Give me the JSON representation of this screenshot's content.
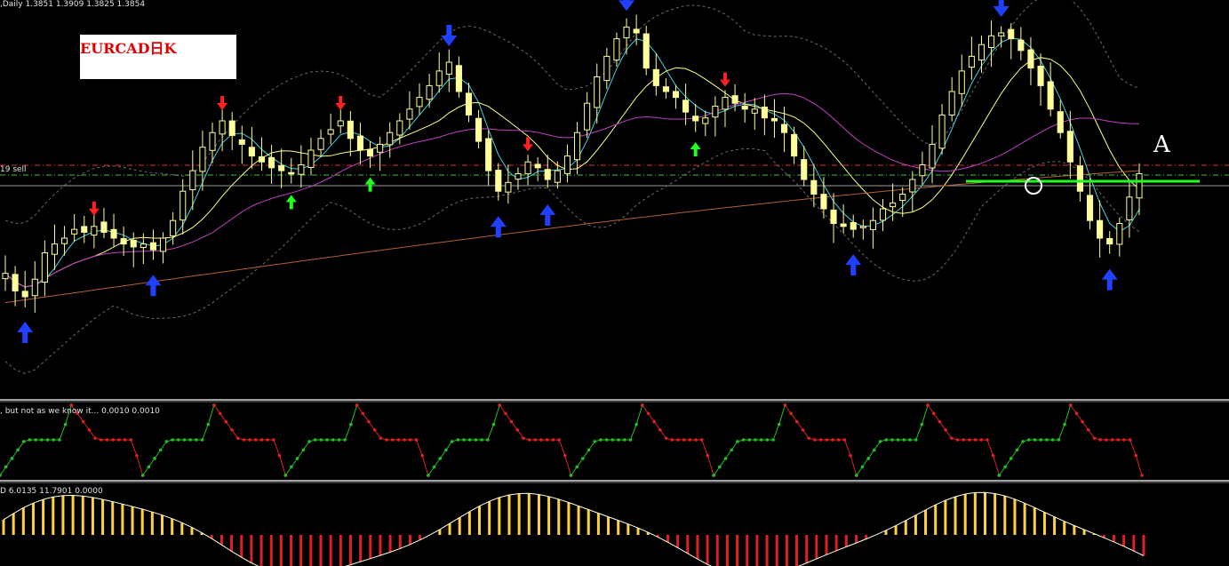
{
  "header": {
    "main_info": ",Daily  1.3851 1.3909 1.3825 1.3854",
    "sell_label": "19 sell",
    "osc1_info": ", but not as we know it...  0.0010 0.0010",
    "osc2_info": "D 6.0135 11.7901 0.0000"
  },
  "annotations": {
    "title": "EURCAD日K",
    "marker": "A"
  },
  "colors": {
    "background": "#000000",
    "candle": "#ffff99",
    "bb_band": "#6a6a6a",
    "ma_fast": "#40d0e0",
    "ma_mid": "#ffff80",
    "ma_slow": "#c040c0",
    "ma_long": "#b06030",
    "sell_line": "#e03030",
    "green_dash": "#40c040",
    "green_level": "#20ff20",
    "arrow_up_green": "#20ff20",
    "arrow_up_blue": "#2040ff",
    "arrow_down_red": "#ff2020",
    "arrow_down_blue": "#2040ff",
    "osc_up": "#20c020",
    "osc_down": "#e02020",
    "hist_up": "#ffd040",
    "hist_down": "#e02020",
    "hist_line": "#ffffe0"
  },
  "chart_data": {
    "type": "candlestick",
    "symbol": "EURCAD",
    "timeframe": "Daily",
    "last_bar": {
      "open": 1.3851,
      "high": 1.3909,
      "low": 1.3825,
      "close": 1.3854
    },
    "price_path": [
      0.28,
      0.22,
      0.2,
      0.26,
      0.35,
      0.38,
      0.4,
      0.43,
      0.42,
      0.44,
      0.42,
      0.4,
      0.38,
      0.37,
      0.38,
      0.36,
      0.4,
      0.46,
      0.56,
      0.63,
      0.71,
      0.76,
      0.8,
      0.75,
      0.72,
      0.68,
      0.66,
      0.64,
      0.63,
      0.62,
      0.65,
      0.7,
      0.74,
      0.77,
      0.8,
      0.74,
      0.7,
      0.68,
      0.72,
      0.76,
      0.8,
      0.84,
      0.88,
      0.92,
      0.97,
      1.0,
      0.9,
      0.82,
      0.73,
      0.63,
      0.56,
      0.59,
      0.62,
      0.66,
      0.64,
      0.6,
      0.63,
      0.68,
      0.76,
      0.86,
      0.95,
      1.02,
      1.08,
      1.12,
      1.1,
      0.98,
      0.92,
      0.9,
      0.88,
      0.83,
      0.8,
      0.81,
      0.85,
      0.88,
      0.86,
      0.84,
      0.84,
      0.81,
      0.8,
      0.76,
      0.68,
      0.6,
      0.55,
      0.5,
      0.45,
      0.44,
      0.43,
      0.44,
      0.46,
      0.5,
      0.52,
      0.55,
      0.6,
      0.65,
      0.72,
      0.82,
      0.9,
      0.97,
      1.02,
      1.06,
      1.09,
      1.1,
      1.08,
      1.04,
      0.98,
      0.92,
      0.84,
      0.76,
      0.66,
      0.56,
      0.46,
      0.4,
      0.38,
      0.45,
      0.54,
      0.62
    ],
    "oscillator_levels": [
      "low",
      "high",
      "low",
      "high",
      "low",
      "high",
      "low",
      "high",
      "low",
      "high",
      "low",
      "high",
      "low",
      "high",
      "low",
      "high"
    ],
    "ranges": {
      "price_min": 0.0,
      "price_max": 1.0
    }
  }
}
